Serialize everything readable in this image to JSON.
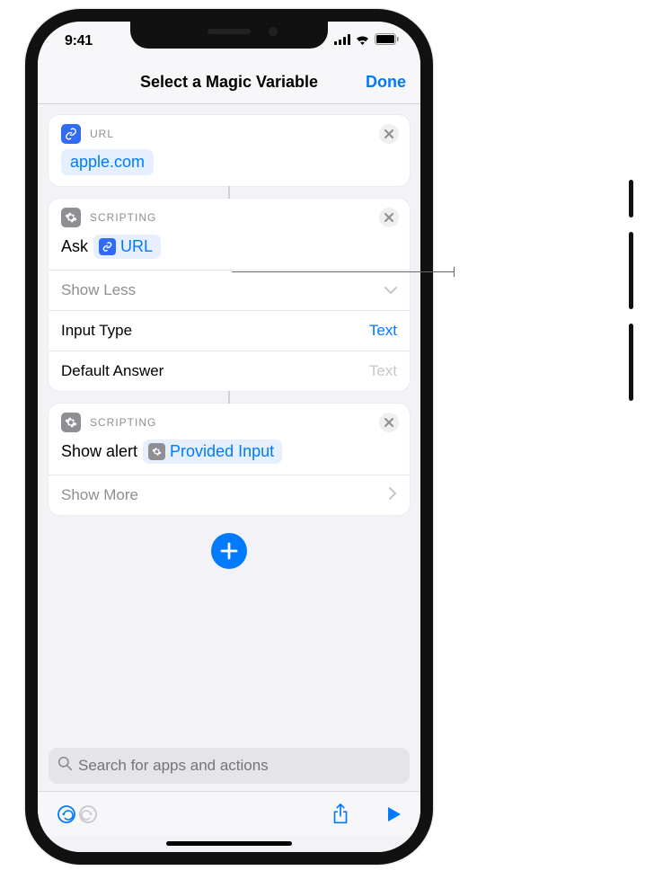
{
  "status": {
    "time": "9:41"
  },
  "nav": {
    "title": "Select a Magic Variable",
    "done": "Done"
  },
  "actions": {
    "url": {
      "category": "URL",
      "value": "apple.com"
    },
    "ask": {
      "category": "SCRIPTING",
      "title": "Ask",
      "varLabel": "URL",
      "showLess": "Show Less",
      "inputTypeLabel": "Input Type",
      "inputTypeValue": "Text",
      "defaultAnswerLabel": "Default Answer",
      "defaultAnswerPlaceholder": "Text"
    },
    "alert": {
      "category": "SCRIPTING",
      "title": "Show alert",
      "varLabel": "Provided Input",
      "showMore": "Show More"
    }
  },
  "search": {
    "placeholder": "Search for apps and actions"
  }
}
